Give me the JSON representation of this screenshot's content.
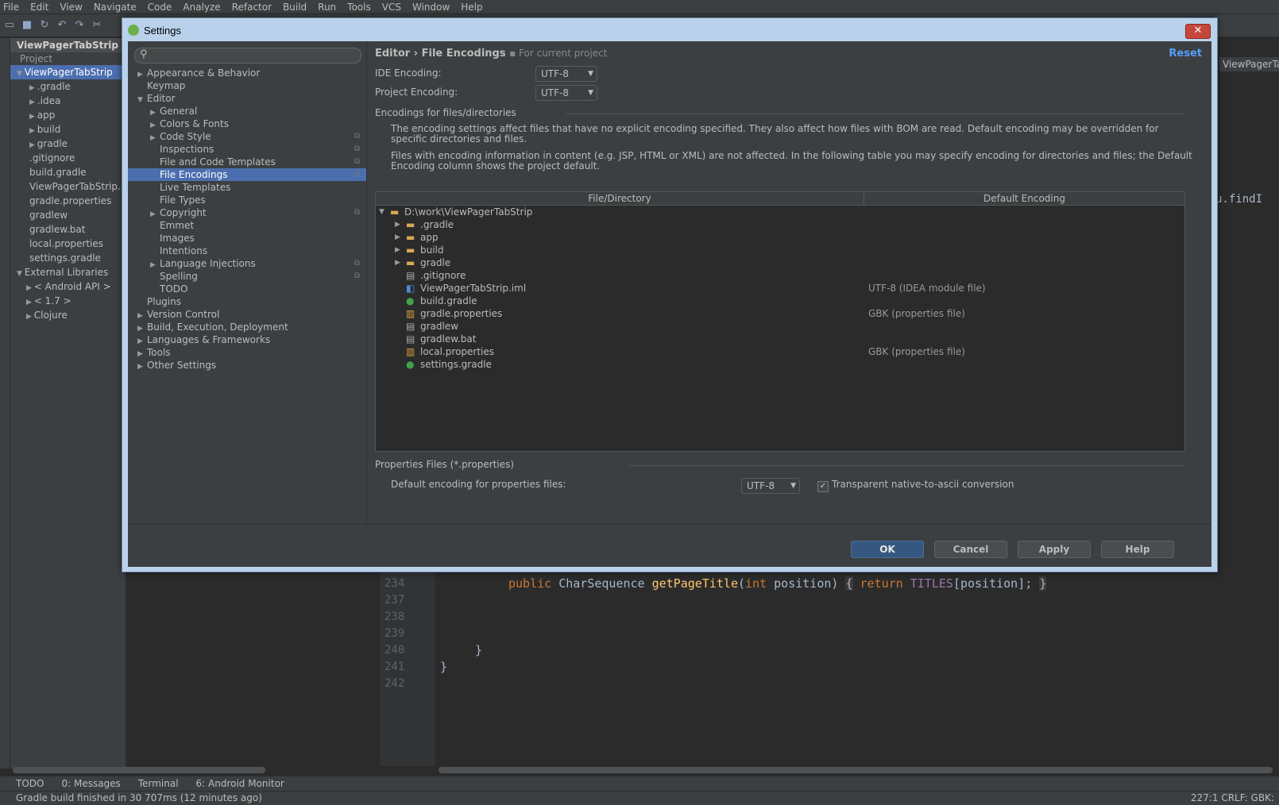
{
  "menubar": [
    "File",
    "Edit",
    "View",
    "Navigate",
    "Code",
    "Analyze",
    "Refactor",
    "Build",
    "Run",
    "Tools",
    "VCS",
    "Window",
    "Help"
  ],
  "project_panel": {
    "title": "ViewPagerTabStrip",
    "subtitle": "Project",
    "items": [
      {
        "label": "ViewPagerTabStrip",
        "sel": true
      },
      {
        "label": ".gradle"
      },
      {
        "label": ".idea"
      },
      {
        "label": "app"
      },
      {
        "label": "build"
      },
      {
        "label": "gradle"
      },
      {
        "label": ".gitignore"
      },
      {
        "label": "build.gradle"
      },
      {
        "label": "ViewPagerTabStrip.iml"
      },
      {
        "label": "gradle.properties"
      },
      {
        "label": "gradlew"
      },
      {
        "label": "gradlew.bat"
      },
      {
        "label": "local.properties"
      },
      {
        "label": "settings.gradle"
      },
      {
        "label": "External Libraries"
      },
      {
        "label": "< Android API >"
      },
      {
        "label": "< 1.7 >"
      },
      {
        "label": "Clojure"
      }
    ]
  },
  "editor": {
    "line_numbers": [
      "234",
      "237",
      "238",
      "239",
      "240",
      "241",
      "242"
    ],
    "code_234": {
      "kw1": "public",
      "type": "CharSequence",
      "fn": "getPageTitle",
      "p_open": "(",
      "kw2": "int",
      "param": "position)",
      "brace_open": "{",
      "kw3": "return",
      "const": "TITLES",
      "rest": "[position];",
      "brace_close": "}"
    },
    "line_240": "}",
    "line_241": "}",
    "right_fragment": "u.findI",
    "right_tab": "ViewPagerTabStrip"
  },
  "tool_tabs": [
    "TODO",
    "0: Messages",
    "Terminal",
    "6: Android Monitor"
  ],
  "status": {
    "message": "Gradle build finished in 30 707ms (12 minutes ago)",
    "position": "227:1  CRLF:  GBK:"
  },
  "dialog": {
    "title": "Settings",
    "close": "✕",
    "search_placeholder": "",
    "tree": [
      {
        "label": "Appearance & Behavior",
        "arrow": "▶",
        "indent": 0
      },
      {
        "label": "Keymap",
        "arrow": "",
        "indent": 0
      },
      {
        "label": "Editor",
        "arrow": "▼",
        "indent": 0
      },
      {
        "label": "General",
        "arrow": "▶",
        "indent": 1
      },
      {
        "label": "Colors & Fonts",
        "arrow": "▶",
        "indent": 1
      },
      {
        "label": "Code Style",
        "arrow": "▶",
        "indent": 1,
        "copy": true
      },
      {
        "label": "Inspections",
        "arrow": "",
        "indent": 1,
        "copy": true
      },
      {
        "label": "File and Code Templates",
        "arrow": "",
        "indent": 1,
        "copy": true
      },
      {
        "label": "File Encodings",
        "arrow": "",
        "indent": 1,
        "copy": true,
        "sel": true
      },
      {
        "label": "Live Templates",
        "arrow": "",
        "indent": 1
      },
      {
        "label": "File Types",
        "arrow": "",
        "indent": 1
      },
      {
        "label": "Copyright",
        "arrow": "▶",
        "indent": 1,
        "copy": true
      },
      {
        "label": "Emmet",
        "arrow": "",
        "indent": 1
      },
      {
        "label": "Images",
        "arrow": "",
        "indent": 1
      },
      {
        "label": "Intentions",
        "arrow": "",
        "indent": 1
      },
      {
        "label": "Language Injections",
        "arrow": "▶",
        "indent": 1,
        "copy": true
      },
      {
        "label": "Spelling",
        "arrow": "",
        "indent": 1,
        "copy": true
      },
      {
        "label": "TODO",
        "arrow": "",
        "indent": 1
      },
      {
        "label": "Plugins",
        "arrow": "",
        "indent": 0
      },
      {
        "label": "Version Control",
        "arrow": "▶",
        "indent": 0
      },
      {
        "label": "Build, Execution, Deployment",
        "arrow": "▶",
        "indent": 0
      },
      {
        "label": "Languages & Frameworks",
        "arrow": "▶",
        "indent": 0
      },
      {
        "label": "Tools",
        "arrow": "▶",
        "indent": 0
      },
      {
        "label": "Other Settings",
        "arrow": "▶",
        "indent": 0
      }
    ],
    "crumb": "Editor › File Encodings",
    "crumb_sub": "For current project",
    "reset": "Reset",
    "ide_encoding_label": "IDE Encoding:",
    "ide_encoding_value": "UTF-8",
    "project_encoding_label": "Project Encoding:",
    "project_encoding_value": "UTF-8",
    "group_label": "Encodings for files/directories",
    "desc1": "The encoding settings affect files that have no explicit encoding specified. They also affect how files with BOM are read. Default encoding may be overridden for specific directories and files.",
    "desc2": "Files with encoding information in content (e.g. JSP, HTML or XML) are not affected. In the following table you may specify encoding for directories and files; the Default Encoding column shows the project default.",
    "col_path": "File/Directory",
    "col_enc": "Default Encoding",
    "rows": [
      {
        "name": "D:\\work\\ViewPagerTabStrip",
        "icon": "folder",
        "arrow": "▼",
        "indent": 0,
        "enc": ""
      },
      {
        "name": ".gradle",
        "icon": "folder",
        "arrow": "▶",
        "indent": 1,
        "enc": ""
      },
      {
        "name": "app",
        "icon": "folder",
        "arrow": "▶",
        "indent": 1,
        "enc": ""
      },
      {
        "name": "build",
        "icon": "folder",
        "arrow": "▶",
        "indent": 1,
        "enc": ""
      },
      {
        "name": "gradle",
        "icon": "folder",
        "arrow": "▶",
        "indent": 1,
        "enc": ""
      },
      {
        "name": ".gitignore",
        "icon": "file",
        "arrow": "",
        "indent": 1,
        "enc": ""
      },
      {
        "name": "ViewPagerTabStrip.iml",
        "icon": "iml",
        "arrow": "",
        "indent": 1,
        "enc": "UTF-8 (IDEA module file)"
      },
      {
        "name": "build.gradle",
        "icon": "g",
        "arrow": "",
        "indent": 1,
        "enc": ""
      },
      {
        "name": "gradle.properties",
        "icon": "chart",
        "arrow": "",
        "indent": 1,
        "enc": "GBK (properties file)"
      },
      {
        "name": "gradlew",
        "icon": "file",
        "arrow": "",
        "indent": 1,
        "enc": ""
      },
      {
        "name": "gradlew.bat",
        "icon": "file",
        "arrow": "",
        "indent": 1,
        "enc": ""
      },
      {
        "name": "local.properties",
        "icon": "chart",
        "arrow": "",
        "indent": 1,
        "enc": "GBK (properties file)"
      },
      {
        "name": "settings.gradle",
        "icon": "g",
        "arrow": "",
        "indent": 1,
        "enc": ""
      }
    ],
    "props_label": "Properties Files (*.properties)",
    "props_default_label": "Default encoding for properties files:",
    "props_default_value": "UTF-8",
    "transparent_label": "Transparent native-to-ascii conversion",
    "buttons": {
      "ok": "OK",
      "cancel": "Cancel",
      "apply": "Apply",
      "help": "Help"
    }
  }
}
